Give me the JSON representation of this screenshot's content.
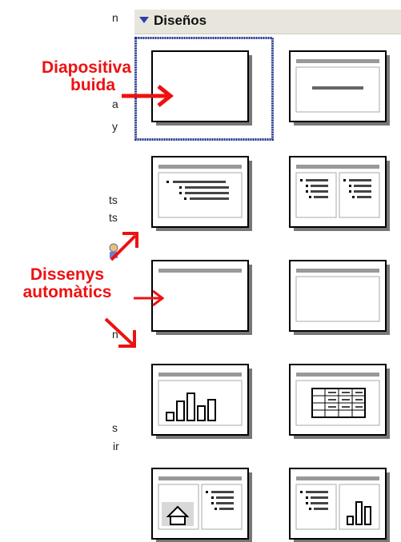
{
  "left_fragments": [
    "n",
    "a",
    "y",
    "ts",
    "ts",
    "n",
    "s",
    "ir"
  ],
  "task_pane": {
    "title": "Diseños"
  },
  "annotations": {
    "blank_line1": "Diapositiva",
    "blank_line2": "buida",
    "auto_line1": "Dissenys",
    "auto_line2": "automàtics"
  },
  "colors": {
    "annotation": "#ee1111",
    "header_bg": "#e8e6dc",
    "selection": "#1a2f8a"
  },
  "layouts": [
    {
      "name": "blank",
      "selected": true
    },
    {
      "name": "title-only-centered"
    },
    {
      "name": "title-and-text"
    },
    {
      "name": "title-and-two-columns-text"
    },
    {
      "name": "title-only"
    },
    {
      "name": "title-and-content"
    },
    {
      "name": "title-and-chart"
    },
    {
      "name": "title-and-table"
    },
    {
      "name": "title-clipart-and-text"
    },
    {
      "name": "title-text-and-chart"
    }
  ]
}
